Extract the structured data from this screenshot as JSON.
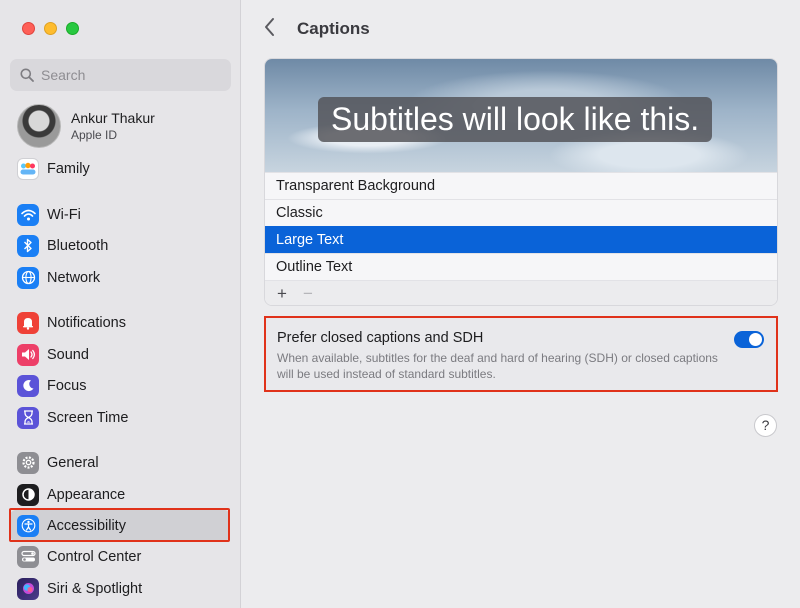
{
  "sidebar": {
    "search_placeholder": "Search",
    "profile": {
      "name": "Ankur Thakur",
      "subtitle": "Apple ID"
    },
    "items": [
      {
        "label": "Family",
        "icon": "family-icon",
        "color": "#ffffff"
      },
      {
        "label": "Wi-Fi",
        "icon": "wifi-icon",
        "color": "#1a7ff5"
      },
      {
        "label": "Bluetooth",
        "icon": "bluetooth-icon",
        "color": "#1a7ff5"
      },
      {
        "label": "Network",
        "icon": "globe-icon",
        "color": "#1a7ff5"
      },
      {
        "label": "Notifications",
        "icon": "bell-icon",
        "color": "#ef4137"
      },
      {
        "label": "Sound",
        "icon": "speaker-icon",
        "color": "#ed3f68"
      },
      {
        "label": "Focus",
        "icon": "moon-icon",
        "color": "#5b53d8"
      },
      {
        "label": "Screen Time",
        "icon": "hourglass-icon",
        "color": "#5b53d8"
      },
      {
        "label": "General",
        "icon": "gear-icon",
        "color": "#8e8e93"
      },
      {
        "label": "Appearance",
        "icon": "appearance-icon",
        "color": "#1d1d1f"
      },
      {
        "label": "Accessibility",
        "icon": "accessibility-icon",
        "color": "#1a7ff5"
      },
      {
        "label": "Control Center",
        "icon": "control-center-icon",
        "color": "#8e8e93"
      },
      {
        "label": "Siri & Spotlight",
        "icon": "siri-icon",
        "color": "#4a3b8c"
      }
    ],
    "selected": "Accessibility"
  },
  "main": {
    "title": "Captions",
    "preview_text": "Subtitles will look like this.",
    "styles": [
      "Transparent Background",
      "Classic",
      "Large Text",
      "Outline Text"
    ],
    "selected_style": "Large Text",
    "add_label": "+",
    "remove_label": "−",
    "pref": {
      "label": "Prefer closed captions and SDH",
      "description": "When available, subtitles for the deaf and hard of hearing (SDH) or closed captions will be used instead of standard subtitles.",
      "enabled": true
    },
    "help_label": "?"
  },
  "colors": {
    "accent": "#0a63d8",
    "highlight_border": "#e0321a"
  }
}
